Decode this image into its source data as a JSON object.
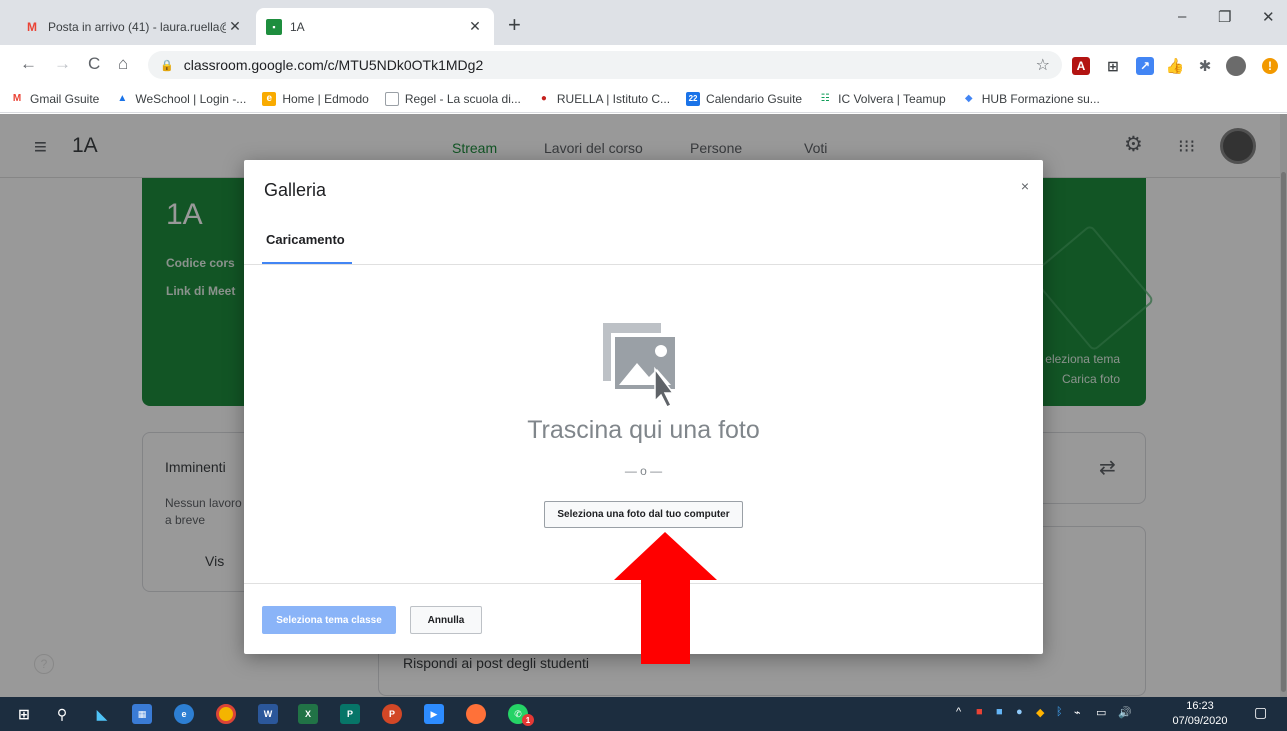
{
  "browser": {
    "tabs": [
      {
        "label": "Posta in arrivo (41) - laura.ruella@",
        "icon": "gmail-icon",
        "active": false
      },
      {
        "label": "1A",
        "icon": "classroom-icon",
        "active": true
      }
    ],
    "new_tab": "+",
    "window_controls": {
      "minimize": "–",
      "restore": "❐",
      "close": "✕"
    },
    "nav": {
      "back": "←",
      "forward": "→",
      "reload": "C",
      "home": "⌂"
    },
    "url": "classroom.google.com/c/MTU5NDk0OTk1MDg2",
    "bookmarks": [
      {
        "label": "Gmail Gsuite",
        "icon": "gmail-icon",
        "color": "#ea4335"
      },
      {
        "label": "WeSchool | Login -...",
        "icon": "weschool-icon",
        "color": "#1a73e8"
      },
      {
        "label": "Home | Edmodo",
        "icon": "edmodo-icon",
        "color": "#f9ab00"
      },
      {
        "label": "Regel - La scuola di...",
        "icon": "page-icon",
        "color": "#9aa0a6"
      },
      {
        "label": "RUELLA | Istituto C...",
        "icon": "school-icon",
        "color": "#c5221f"
      },
      {
        "label": "Calendario Gsuite",
        "icon": "calendar-icon",
        "color": "#1a73e8"
      },
      {
        "label": "IC Volvera | Teamup",
        "icon": "teamup-icon",
        "color": "#0f9d58"
      },
      {
        "label": "HUB Formazione su...",
        "icon": "hub-icon",
        "color": "#4285f4"
      }
    ]
  },
  "classroom": {
    "class_name": "1A",
    "tabs": [
      "Stream",
      "Lavori del corso",
      "Persone",
      "Voti"
    ],
    "banner": {
      "title": "1A",
      "code_label": "Codice cors",
      "meet_label": "Link di Meet",
      "select_theme": "eleziona tema",
      "upload_photo": "Carica foto"
    },
    "upcoming": {
      "title": "Imminenti",
      "text_line1": "Nessun lavoro",
      "text_line2": "a breve",
      "view_all": "Vis"
    },
    "post_hint": "Rispondi ai post degli studenti"
  },
  "dialog": {
    "title": "Galleria",
    "close": "×",
    "tab": "Caricamento",
    "drop_text": "Trascina qui una foto",
    "or_text": "— o —",
    "select_button": "Seleziona una foto dal tuo computer",
    "primary_button": "Seleziona tema classe",
    "cancel_button": "Annulla"
  },
  "taskbar": {
    "time": "16:23",
    "date": "07/09/2020",
    "whatsapp_badge": "1"
  },
  "colors": {
    "classroom_green": "#1e8e3e",
    "arrow_red": "#ff0000",
    "primary_disabled": "#8ab4f8"
  }
}
